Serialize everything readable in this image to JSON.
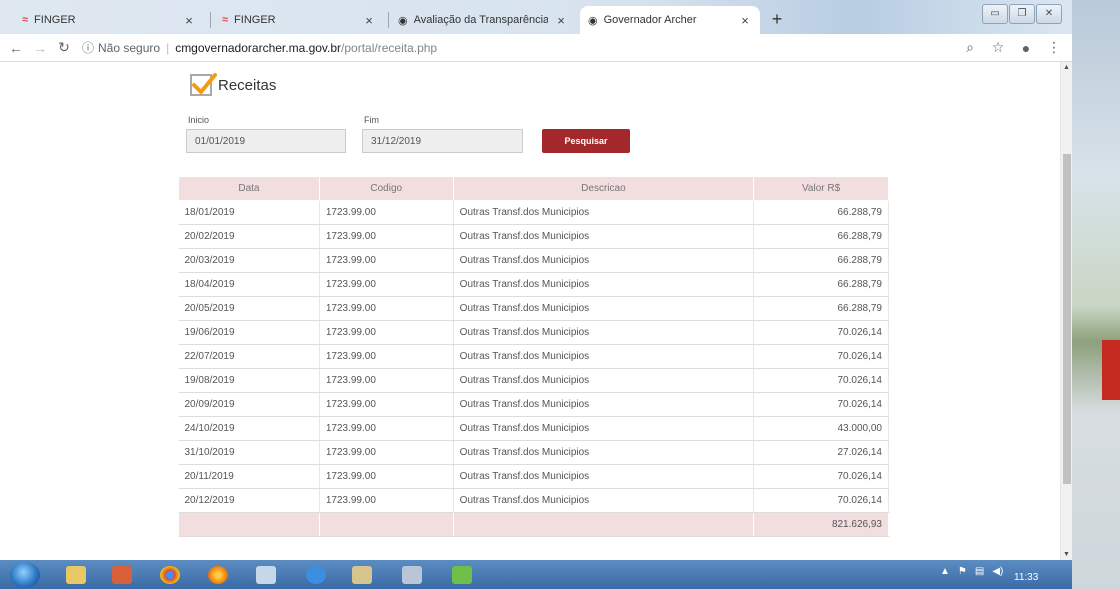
{
  "browser": {
    "tabs": [
      {
        "title": "FINGER",
        "close": "×"
      },
      {
        "title": "FINGER",
        "close": "×"
      },
      {
        "title": "Avaliação da Transparência dos /",
        "close": "×"
      },
      {
        "title": "Governador Archer",
        "close": "×"
      }
    ],
    "new_tab": "+",
    "address": {
      "security": "Não seguro",
      "host": "cmgovernadorarcher.ma.gov.br",
      "path": "/portal/receita.php"
    }
  },
  "page": {
    "title": "Receitas",
    "filters": {
      "start_label": "Inicio",
      "start_value": "01/01/2019",
      "end_label": "Fim",
      "end_value": "31/12/2019",
      "search_label": "Pesquisar"
    },
    "table": {
      "headers": [
        "Data",
        "Codigo",
        "Descricao",
        "Valor R$"
      ],
      "rows": [
        [
          "18/01/2019",
          "1723.99.00",
          "Outras Transf.dos Municipios",
          "66.288,79"
        ],
        [
          "20/02/2019",
          "1723.99.00",
          "Outras Transf.dos Municipios",
          "66.288,79"
        ],
        [
          "20/03/2019",
          "1723.99.00",
          "Outras Transf.dos Municipios",
          "66.288,79"
        ],
        [
          "18/04/2019",
          "1723.99.00",
          "Outras Transf.dos Municipios",
          "66.288,79"
        ],
        [
          "20/05/2019",
          "1723.99.00",
          "Outras Transf.dos Municipios",
          "66.288,79"
        ],
        [
          "19/06/2019",
          "1723.99.00",
          "Outras Transf.dos Municipios",
          "70.026,14"
        ],
        [
          "22/07/2019",
          "1723.99.00",
          "Outras Transf.dos Municipios",
          "70.026,14"
        ],
        [
          "19/08/2019",
          "1723.99.00",
          "Outras Transf.dos Municipios",
          "70.026,14"
        ],
        [
          "20/09/2019",
          "1723.99.00",
          "Outras Transf.dos Municipios",
          "70.026,14"
        ],
        [
          "24/10/2019",
          "1723.99.00",
          "Outras Transf.dos Municipios",
          "43.000,00"
        ],
        [
          "31/10/2019",
          "1723.99.00",
          "Outras Transf.dos Municipios",
          "27.026,14"
        ],
        [
          "20/11/2019",
          "1723.99.00",
          "Outras Transf.dos Municipios",
          "70.026,14"
        ],
        [
          "20/12/2019",
          "1723.99.00",
          "Outras Transf.dos Municipios",
          "70.026,14"
        ]
      ],
      "total": "821.626,93"
    }
  },
  "taskbar": {
    "time": "11:33"
  },
  "colors": {
    "accent": "#a3282b",
    "table_header_bg": "#f2dede",
    "check_orange": "#f39c12"
  }
}
